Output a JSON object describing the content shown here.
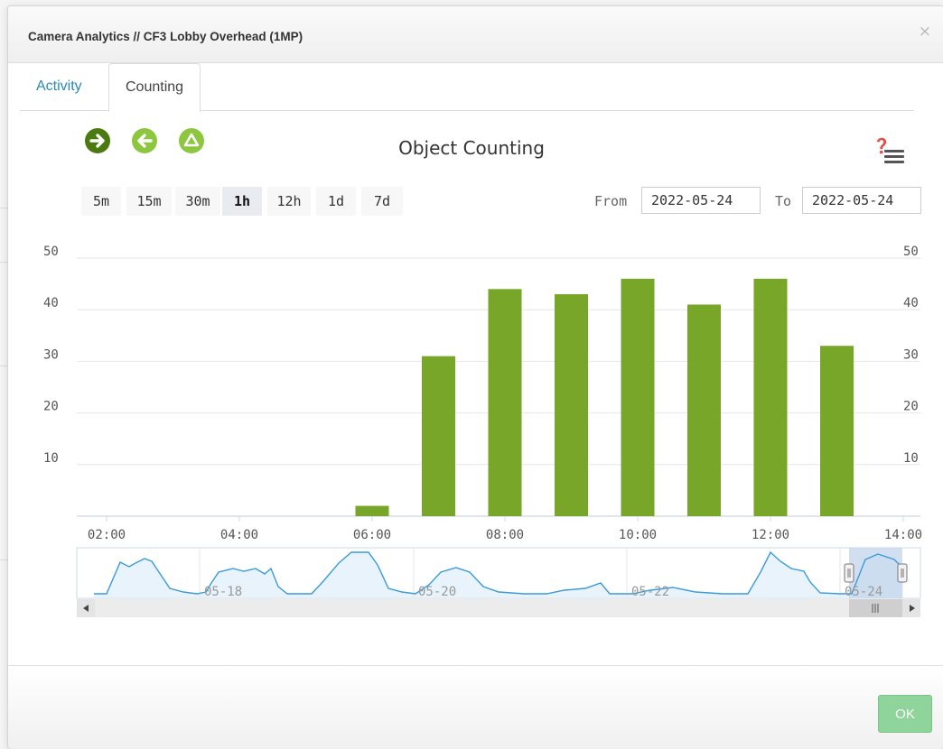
{
  "dialog": {
    "title": "Camera Analytics // CF3 Lobby Overhead (1MP)",
    "close_label": "×",
    "ok_label": "OK"
  },
  "tabs": [
    {
      "label": "Activity",
      "active": false
    },
    {
      "label": "Counting",
      "active": true
    }
  ],
  "toolbar": {
    "icons": [
      "arrow-right-circle-icon",
      "arrow-left-circle-icon",
      "triangle-up-circle-icon"
    ],
    "help_glyph": "❓",
    "help_icon": "help-menu-icon"
  },
  "time_ranges": [
    {
      "label": "5m",
      "selected": false
    },
    {
      "label": "15m",
      "selected": false
    },
    {
      "label": "30m",
      "selected": false
    },
    {
      "label": "1h",
      "selected": true
    },
    {
      "label": "12h",
      "selected": false
    },
    {
      "label": "1d",
      "selected": false
    },
    {
      "label": "7d",
      "selected": false
    }
  ],
  "date_range": {
    "from_label": "From",
    "from_value": "2022-05-24",
    "to_label": "To",
    "to_value": "2022-05-24"
  },
  "colors": {
    "bar": "#77a628",
    "icon_dark": "#4d7c12",
    "icon_light": "#8dc63f",
    "navigator_line": "#3a9bd9"
  },
  "chart_data": {
    "type": "bar",
    "title": "Object Counting",
    "ylim": [
      0,
      50
    ],
    "y_ticks": [
      10,
      20,
      30,
      40,
      50
    ],
    "x_ticks": [
      "02:00",
      "04:00",
      "06:00",
      "08:00",
      "10:00",
      "12:00",
      "14:00"
    ],
    "categories": [
      "06:00",
      "07:00",
      "08:00",
      "09:00",
      "10:00",
      "11:00",
      "12:00",
      "13:00"
    ],
    "values": [
      2,
      31,
      44,
      43,
      46,
      41,
      46,
      33
    ],
    "grid": true,
    "navigator": {
      "labels": [
        "05-18",
        "05-20",
        "05-22",
        "05-24"
      ]
    }
  }
}
